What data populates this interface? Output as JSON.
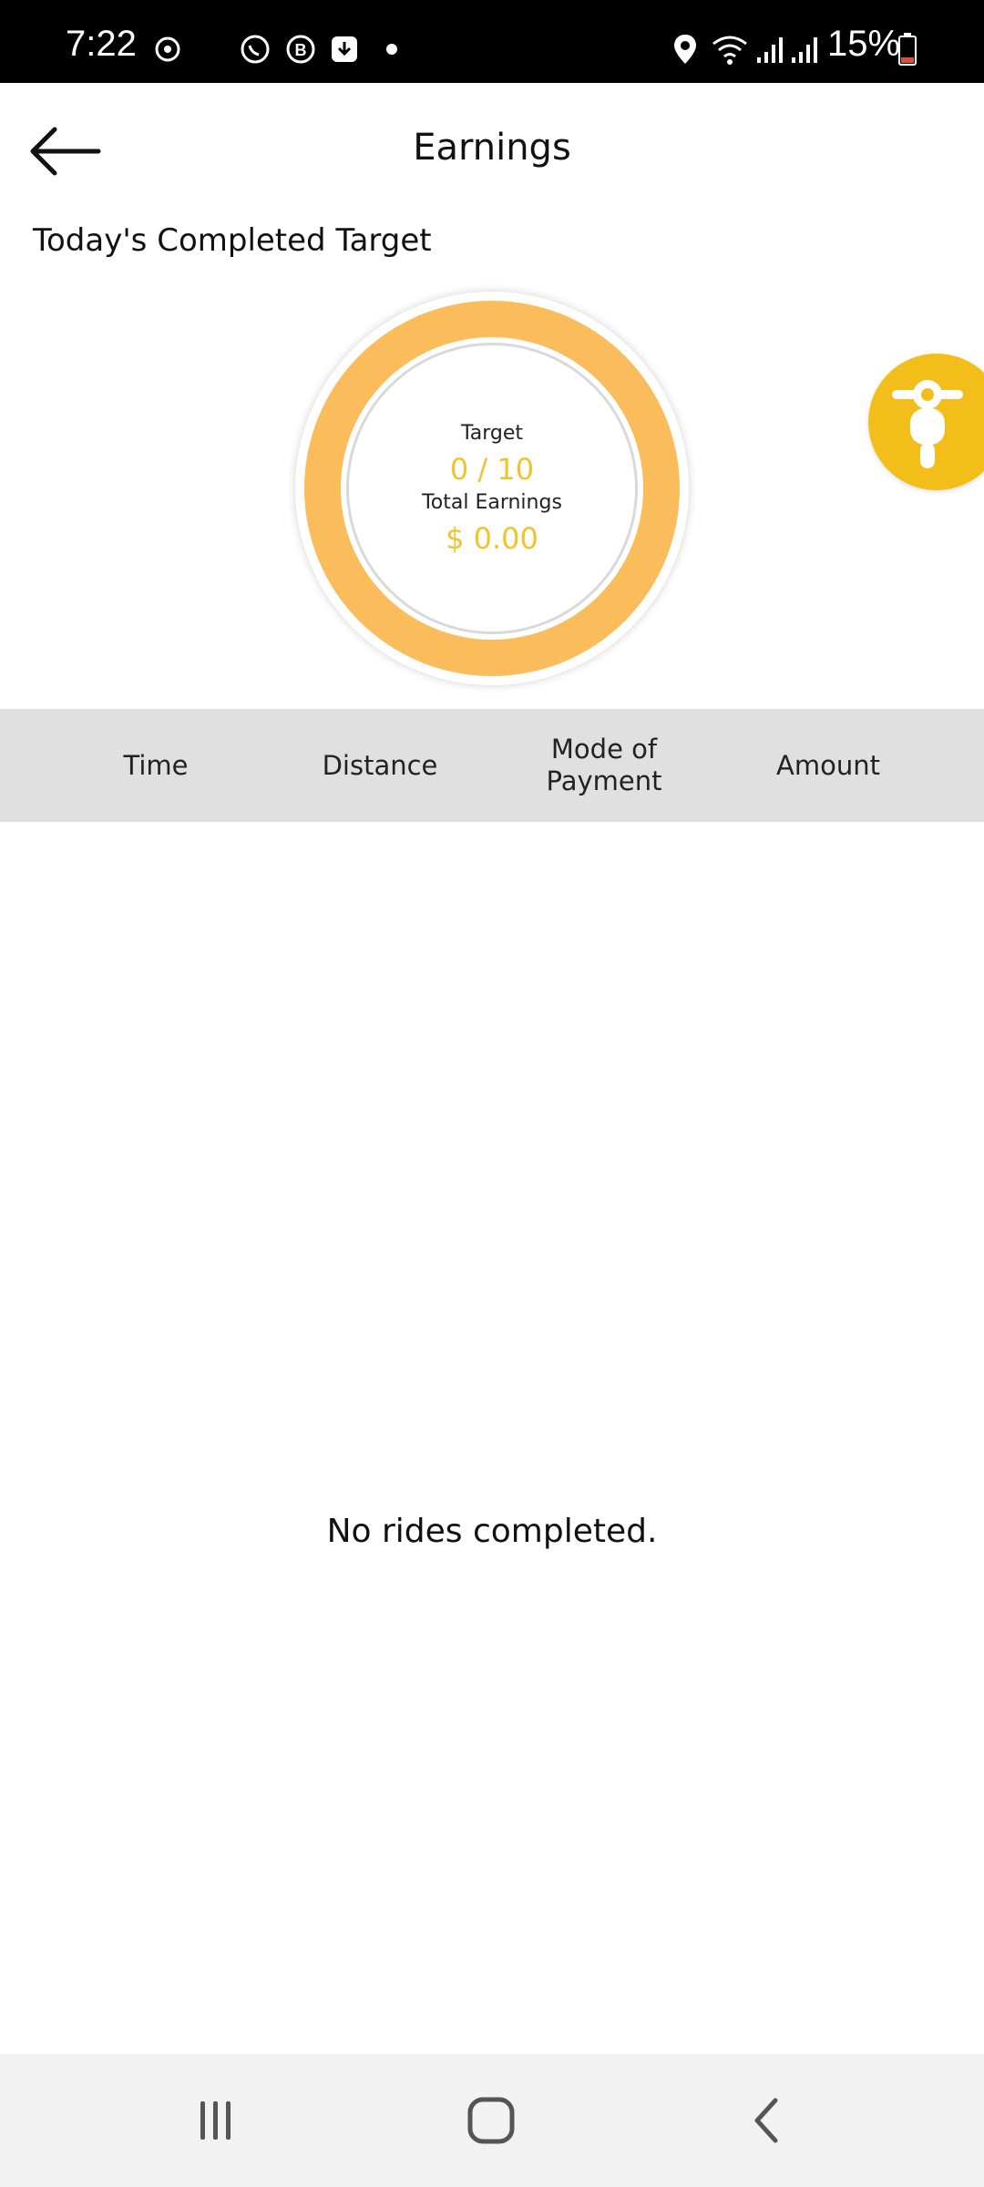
{
  "status_bar": {
    "time": "7:22",
    "battery": "15%",
    "icons": [
      "sync-icon",
      "whatsapp-icon",
      "b-icon",
      "download-icon",
      "dot-icon",
      "location-icon",
      "wifi-icon",
      "signal-icon",
      "signal-icon",
      "battery-icon"
    ]
  },
  "header": {
    "title": "Earnings",
    "back_icon": "arrow-left-icon"
  },
  "section_title": "Today's Completed Target",
  "target": {
    "label": "Target",
    "value": "0 / 10",
    "completed": 0,
    "total": 10,
    "earnings_label": "Total Earnings",
    "earnings_value": "$ 0.00"
  },
  "fab": {
    "icon": "motorbike-icon"
  },
  "table": {
    "columns": [
      "Time",
      "Distance",
      "Mode of\nPayment",
      "Amount"
    ]
  },
  "empty_message": "No rides completed.",
  "nav": {
    "recent_icon": "recent-apps-icon",
    "home_icon": "home-icon",
    "back_icon": "nav-back-icon"
  },
  "colors": {
    "ring": "#fbbd5c",
    "accent_text": "#f0c330",
    "fab": "#f3bd1a",
    "table_header_bg": "#e0e0e0"
  }
}
